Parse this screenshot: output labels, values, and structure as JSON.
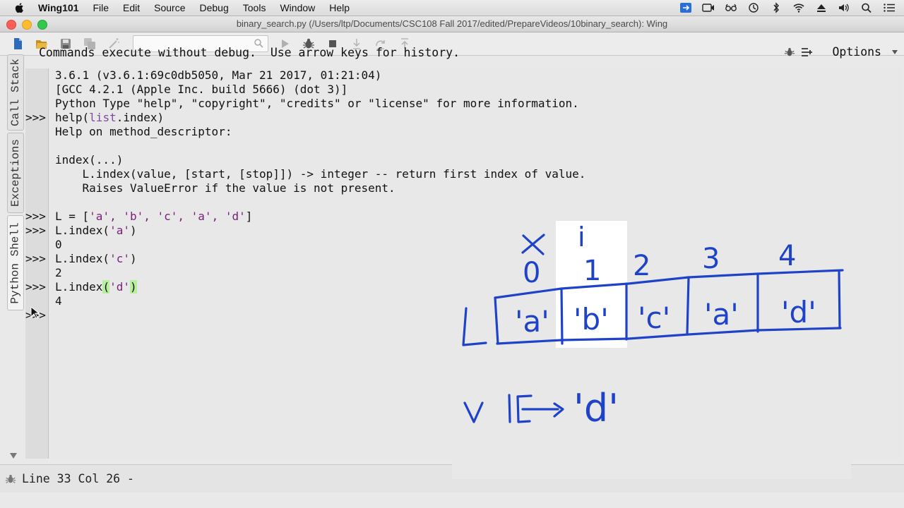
{
  "menubar": {
    "app": "Wing101",
    "items": [
      "File",
      "Edit",
      "Source",
      "Debug",
      "Tools",
      "Window",
      "Help"
    ]
  },
  "window": {
    "title": "binary_search.py (/Users/ltp/Documents/CSC108 Fall 2017/edited/PrepareVideos/10binary_search): Wing"
  },
  "toolbar": {
    "search_value": ""
  },
  "sidetabs": [
    "Call Stack",
    "Exceptions",
    "Python Shell"
  ],
  "shell": {
    "header_message": "Commands execute without debug.  Use arrow keys for history.",
    "options_label": "Options",
    "lines": [
      {
        "prompt": "",
        "text": "3.6.1 (v3.6.1:69c0db5050, Mar 21 2017, 01:21:04)"
      },
      {
        "prompt": "",
        "text": "[GCC 4.2.1 (Apple Inc. build 5666) (dot 3)]"
      },
      {
        "prompt": "",
        "text": "Python Type \"help\", \"copyright\", \"credits\" or \"license\" for more information."
      },
      {
        "prompt": ">>>",
        "pre": "help(",
        "mid": "list",
        "post": ".index)"
      },
      {
        "prompt": "",
        "text": "Help on method_descriptor:"
      },
      {
        "prompt": "",
        "text": ""
      },
      {
        "prompt": "",
        "text": "index(...)"
      },
      {
        "prompt": "",
        "text": "    L.index(value, [start, [stop]]) -> integer -- return first index of value."
      },
      {
        "prompt": "",
        "text": "    Raises ValueError if the value is not present."
      },
      {
        "prompt": "",
        "text": ""
      },
      {
        "prompt": ">>>",
        "pre": "L = [",
        "mid": "'a', 'b', 'c', 'a', 'd'",
        "post": "]"
      },
      {
        "prompt": ">>>",
        "pre": "L.index(",
        "mid": "'a'",
        "post": ")"
      },
      {
        "prompt": "",
        "text": "0"
      },
      {
        "prompt": ">>>",
        "pre": "L.index(",
        "mid": "'c'",
        "post": ")"
      },
      {
        "prompt": "",
        "text": "2"
      },
      {
        "prompt": ">>>",
        "pre": "L.index",
        "hl": "(",
        "mid": "'d'",
        "hl2": ")"
      },
      {
        "prompt": "",
        "text": "4"
      },
      {
        "prompt": ">>>",
        "text": ""
      }
    ]
  },
  "statusbar": {
    "text": "Line 33 Col 26 -"
  },
  "annotation": {
    "list_name": "L",
    "indices": [
      "0",
      "1",
      "2",
      "3",
      "4"
    ],
    "crossed_index": "x",
    "pointer": "i",
    "cells": [
      "'a'",
      "'b'",
      "'c'",
      "'a'",
      "'d'"
    ],
    "v_line": "v",
    "v_value": "'d'"
  },
  "colors": {
    "ink": "#1f43c8",
    "string": "#7a1d7a",
    "bracket_highlight": "#b7ef9e"
  }
}
